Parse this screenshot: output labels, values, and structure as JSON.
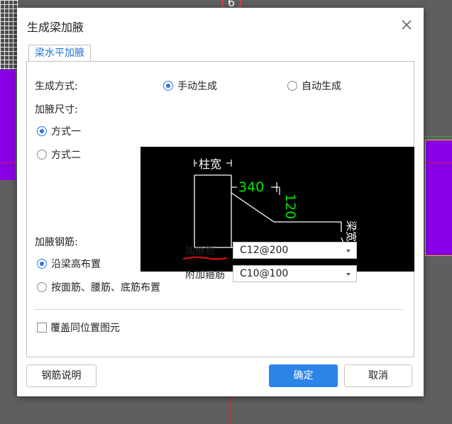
{
  "dialog": {
    "title": "生成梁加腋"
  },
  "tab": {
    "label": "梁水平加腋"
  },
  "generation": {
    "label": "生成方式:",
    "manual": "手动生成",
    "auto": "自动生成",
    "selected": "manual"
  },
  "size": {
    "label": "加腋尺寸:",
    "option1": "方式一",
    "option2": "方式二",
    "selected": "option1"
  },
  "diagram": {
    "column_width": "柱宽",
    "dim_horizontal": "340",
    "dim_vertical": "120",
    "beam_width": "梁宽"
  },
  "rebar": {
    "label": "加腋钢筋:",
    "along_height": "沿梁高布置",
    "by_faces": "按面筋、腰筋、底筋布置",
    "selected": "along_height"
  },
  "fields": {
    "haunch_rebar_label": "加腋筋",
    "haunch_rebar_value": "C12@200",
    "stirrup_label": "附加箍筋",
    "stirrup_value": "C10@100"
  },
  "override": {
    "label": "覆盖同位置图元",
    "checked": false
  },
  "buttons": {
    "rebar_help": "钢筋说明",
    "ok": "确定",
    "cancel": "取消"
  },
  "background": {
    "axis_number": "6"
  },
  "colors": {
    "accent": "#2b84e8",
    "tab_text": "#1c73d9",
    "purple": "#8a00e6",
    "dim_green": "#00e600",
    "annotation_red": "#d01010"
  }
}
